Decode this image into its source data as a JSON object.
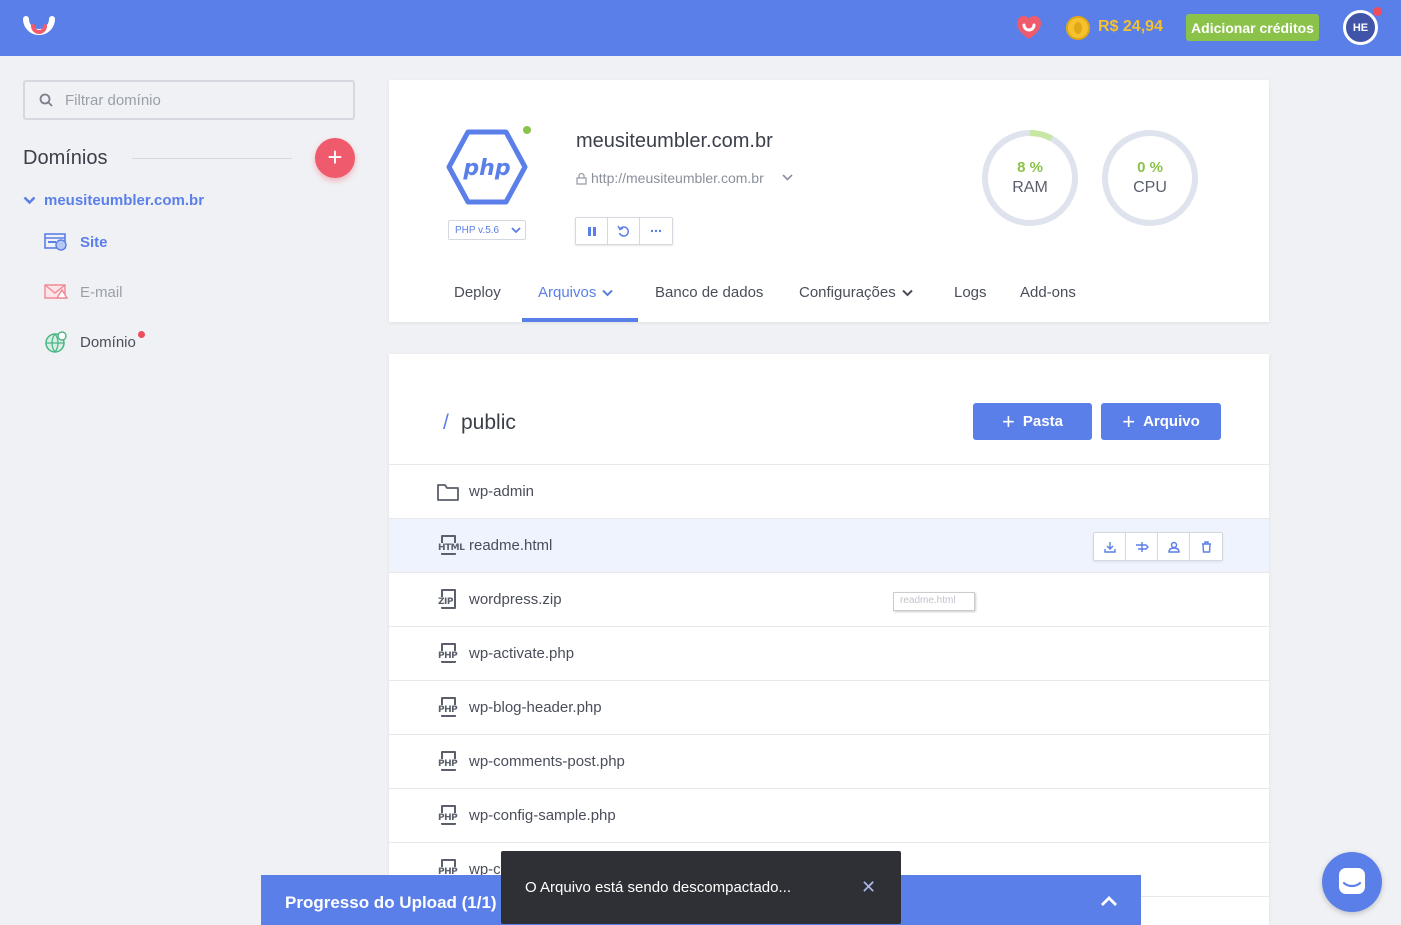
{
  "header": {
    "balance": "R$ 24,94",
    "add_credits_label": "Adicionar créditos",
    "avatar_initials": "HE",
    "brand_color": "#5b7fe8"
  },
  "sidebar": {
    "search_placeholder": "Filtrar domínio",
    "section_title": "Domínios",
    "domain": "meusiteumbler.com.br",
    "items": [
      {
        "label": "Site",
        "icon": "site-icon"
      },
      {
        "label": "E-mail",
        "icon": "email-icon"
      },
      {
        "label": "Domínio",
        "icon": "globe-icon"
      }
    ]
  },
  "app": {
    "name": "meusiteumbler.com.br",
    "url": "http://meusiteumbler.com.br",
    "php_version": "PHP v.5.6",
    "logo_text": "php",
    "controls": [
      "pause-icon",
      "restart-icon",
      "more-icon"
    ],
    "gauges": [
      {
        "value": "8 %",
        "label": "RAM",
        "percent": 8
      },
      {
        "value": "0 %",
        "label": "CPU",
        "percent": 0
      }
    ]
  },
  "tabs": [
    {
      "label": "Deploy"
    },
    {
      "label": "Arquivos"
    },
    {
      "label": "Banco de dados"
    },
    {
      "label": "Configurações"
    },
    {
      "label": "Logs"
    },
    {
      "label": "Add-ons"
    }
  ],
  "files": {
    "path_slash": "/",
    "path": "public",
    "new_folder_label": "Pasta",
    "new_file_label": "Arquivo",
    "list": [
      {
        "name": "wp-admin",
        "type": "folder"
      },
      {
        "name": "readme.html",
        "type": "HTML"
      },
      {
        "name": "wordpress.zip",
        "type": "ZIP"
      },
      {
        "name": "wp-activate.php",
        "type": "PHP"
      },
      {
        "name": "wp-blog-header.php",
        "type": "PHP"
      },
      {
        "name": "wp-comments-post.php",
        "type": "PHP"
      },
      {
        "name": "wp-config-sample.php",
        "type": "PHP"
      },
      {
        "name": "wp-c",
        "type": "PHP"
      }
    ],
    "tooltip": "readme.html",
    "row_actions": [
      "download-icon",
      "move-icon",
      "permission-icon",
      "trash-icon"
    ]
  },
  "upload": {
    "title": "Progresso do Upload (1/1)"
  },
  "toast": {
    "message": "O Arquivo está sendo descompactado...",
    "close": "✕"
  }
}
